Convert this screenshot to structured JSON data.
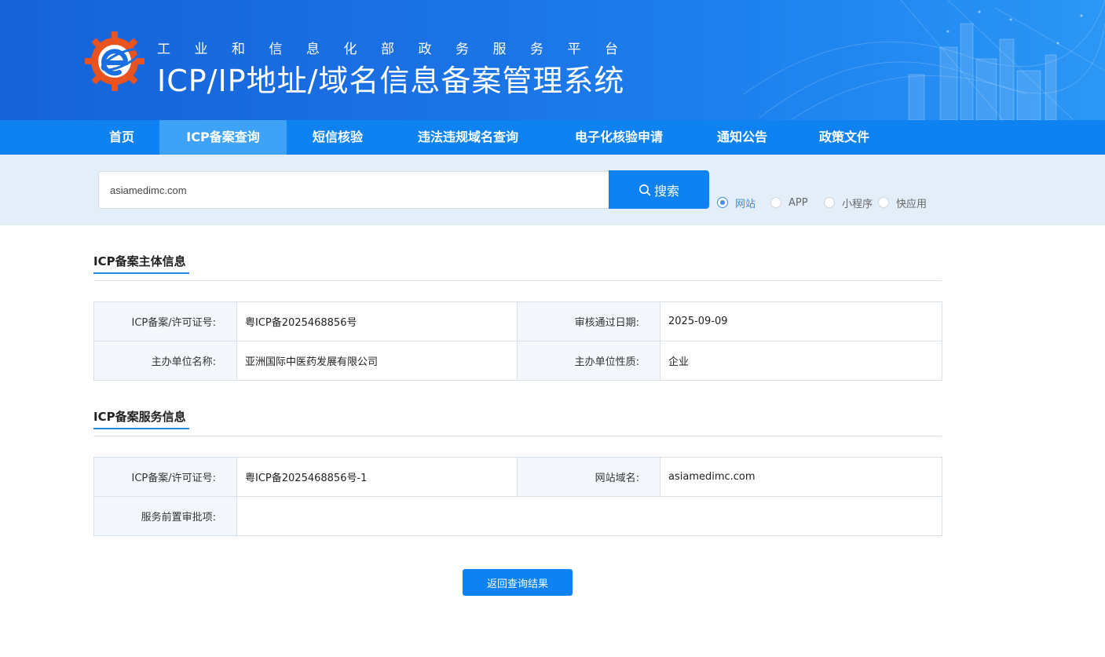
{
  "header": {
    "subtitle": "工业和信息化部政务服务平台",
    "title": "ICP/IP地址/域名信息备案管理系统"
  },
  "nav": {
    "items": [
      {
        "label": "首页"
      },
      {
        "label": "ICP备案查询"
      },
      {
        "label": "短信核验"
      },
      {
        "label": "违法违规域名查询"
      },
      {
        "label": "电子化核验申请"
      },
      {
        "label": "通知公告"
      },
      {
        "label": "政策文件"
      }
    ],
    "active_index": 1
  },
  "search": {
    "value": "asiamedimc.com",
    "button_label": "搜索",
    "options": [
      {
        "label": "网站",
        "checked": true
      },
      {
        "label": "APP",
        "checked": false
      },
      {
        "label": "小程序",
        "checked": false
      },
      {
        "label": "快应用",
        "checked": false
      }
    ]
  },
  "subject_info": {
    "title": "ICP备案主体信息",
    "rows": [
      {
        "k1": "ICP备案/许可证号:",
        "v1": "粤ICP备2025468856号",
        "k2": "审核通过日期:",
        "v2": "2025-09-09"
      },
      {
        "k1": "主办单位名称:",
        "v1": "亚洲国际中医药发展有限公司",
        "k2": "主办单位性质:",
        "v2": "企业"
      }
    ]
  },
  "service_info": {
    "title": "ICP备案服务信息",
    "rows": [
      {
        "k1": "ICP备案/许可证号:",
        "v1": "粤ICP备2025468856号-1",
        "k2": "网站域名:",
        "v2": "asiamedimc.com"
      },
      {
        "k1": "服务前置审批项:",
        "v1": ""
      }
    ]
  },
  "back_button": {
    "label": "返回查询结果"
  },
  "colors": {
    "primary": "#0d82f0",
    "nav_active": "#3ea3f7",
    "banner_dark": "#1662d8",
    "logo_orange": "#e8531f"
  }
}
